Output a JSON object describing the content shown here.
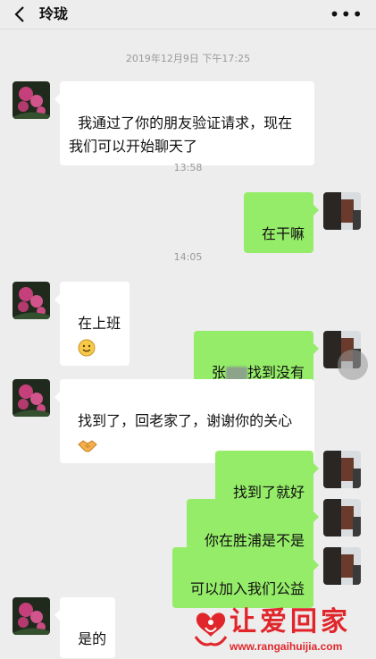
{
  "header": {
    "title": "玲珑",
    "more_label": "•••"
  },
  "timestamps": [
    "2019年12月9日 下午17:25",
    "13:58",
    "14:05"
  ],
  "messages": [
    {
      "side": "left",
      "text": "我通过了你的朋友验证请求，现在\n我们可以开始聊天了"
    },
    {
      "side": "right",
      "text": "在干嘛"
    },
    {
      "side": "left",
      "text": "在上班",
      "emoji": "smile-emoji"
    },
    {
      "side": "right",
      "prefix": "张",
      "suffix": "找到没有"
    },
    {
      "side": "left",
      "text": "找到了，回老家了，谢谢你的关心",
      "emoji": "handshake-emoji"
    },
    {
      "side": "right",
      "text": "找到了就好"
    },
    {
      "side": "right",
      "text": "你在胜浦是不是"
    },
    {
      "side": "right",
      "text": "可以加入我们公益"
    },
    {
      "side": "left",
      "text": "是的"
    }
  ],
  "watermark": {
    "text": "让爱回家",
    "url": "www.rangaihuijia.com",
    "color": "#e0262b"
  },
  "colors": {
    "background": "#ededed",
    "my_bubble": "#95ec69",
    "their_bubble": "#ffffff"
  }
}
